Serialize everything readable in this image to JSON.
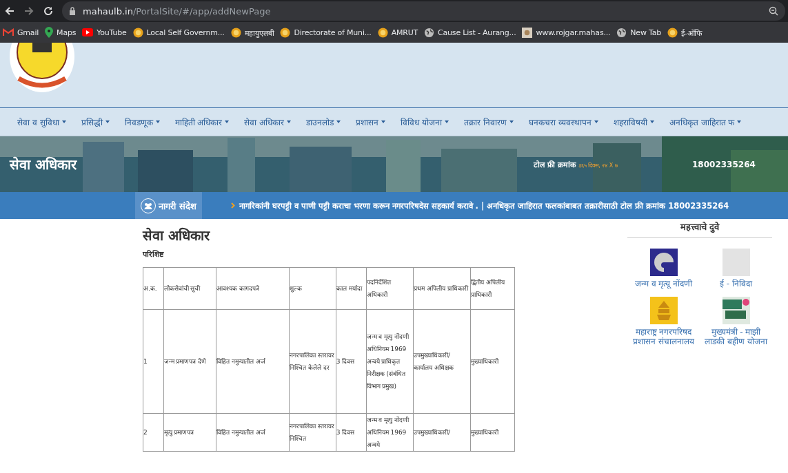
{
  "browser": {
    "url_host": "mahaulb.in",
    "url_path": "/PortalSite/#/app/addNewPage",
    "bookmarks": [
      {
        "label": "Gmail",
        "kind": "mail"
      },
      {
        "label": "Maps",
        "kind": "pin"
      },
      {
        "label": "YouTube",
        "kind": "play"
      },
      {
        "label": "Local Self Governm...",
        "kind": "seal"
      },
      {
        "label": "महायुएलबी",
        "kind": "seal"
      },
      {
        "label": "Directorate of Muni...",
        "kind": "seal"
      },
      {
        "label": "AMRUT",
        "kind": "seal"
      },
      {
        "label": "Cause List - Aurang...",
        "kind": "globe"
      },
      {
        "label": "www.rojgar.mahas...",
        "kind": "square"
      },
      {
        "label": "New Tab",
        "kind": "globe"
      },
      {
        "label": "ई-ऑफि",
        "kind": "seal"
      }
    ]
  },
  "nav": {
    "items": [
      {
        "label": "सेवा व सुविधा"
      },
      {
        "label": "प्रसिद्धी"
      },
      {
        "label": "निवडणूक"
      },
      {
        "label": "माहिती अधिकार"
      },
      {
        "label": "सेवा अधिकार"
      },
      {
        "label": "डाउनलोड"
      },
      {
        "label": "प्रशासन"
      },
      {
        "label": "विविध योजना"
      },
      {
        "label": "तक्रार निवारण"
      },
      {
        "label": "घनकचरा व्यवस्थापन"
      },
      {
        "label": "शहराविषयी"
      },
      {
        "label": "अनधिकृत जाहिरात फ"
      }
    ]
  },
  "banner": {
    "title": "सेवा अधिकार",
    "toll_free_label": "टोल फ्री क्रमांक",
    "toll_free_hours": "३६५ दिवस, २४ X ७",
    "toll_free_number": "18002335264"
  },
  "ticker": {
    "label": "नागरी संदेश",
    "text": "नागरिकांनी घरपट्टी व पाणी पट्टी कराचा भरणा करून नगरपरिषदेस सहकार्य करावे . | अनधिकृत जाहिरात फलकांबाबत तक्रारीसाठी टोल फ्री क्रमांक 18002335264"
  },
  "content": {
    "title": "सेवा अधिकार",
    "subtitle": "परिशिष्ट",
    "table": {
      "columns": [
        "अ.क.",
        "लोकसेवांची सूची",
        "आवश्यक कागदपत्रे",
        "शुल्क",
        "काल मर्यादा",
        "पदनिर्देशित अधिकारी",
        "प्रथम अपिलीय प्राधिकारी",
        "द्वितीय अपिलीय प्राधिकारी"
      ],
      "rows": [
        [
          "1",
          "जन्म प्रमाणपत्र देणे",
          "विहित नमुन्यातील अर्ज",
          "नगरपालिका स्तरावर निश्चित केलेले दर",
          "3 दिवस",
          "जन्म व मृत्यु नोंदणी अधिनियम 1969 अन्वये प्राधिकृत निरीक्षक (संबंधित विभाग प्रमुख)",
          "उपमुख्याधिकारी/ कार्यालय अधिक्षक",
          "मुख्याधिकारी"
        ],
        [
          "2",
          "मृत्यु प्रमाणपत्र",
          "विहित नमुन्यातील अर्ज",
          "नगरपालिका स्तरावर निश्चित",
          "3 दिवस",
          "जन्म व मृत्यु नोंदणी अधिनियम 1969 अन्वये",
          "उपमुख्याधिकारी/",
          "मुख्याधिकारी"
        ]
      ]
    }
  },
  "sidebar": {
    "title": "महत्त्वाचे दुवे",
    "links": [
      {
        "label": "जन्म व मृत्यू नोंदणी",
        "kind": "swirl"
      },
      {
        "label": "ई - निविदा",
        "kind": "blank"
      },
      {
        "label": "महाराष्ट्र नगरपरिषद प्रशासन संचालनालय",
        "kind": "emblem"
      },
      {
        "label": "मुख्यमंत्री - माझी लाडकी बहीण योजना",
        "kind": "poster"
      }
    ]
  }
}
